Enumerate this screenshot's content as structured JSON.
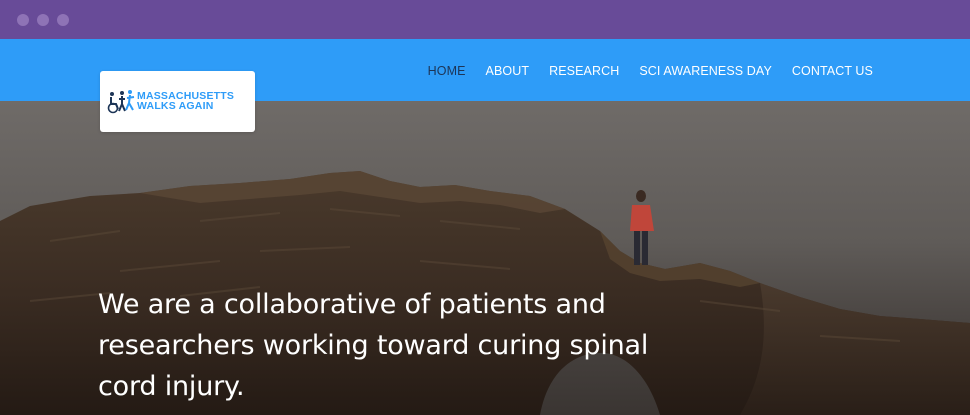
{
  "window": {
    "controls": [
      "close",
      "minimize",
      "maximize"
    ]
  },
  "brand": {
    "line1": "MASSACHUSETTS",
    "line2": "WALKS AGAIN",
    "logo_icon": "people-walking-wheelchair-icon",
    "color": "#2e9cf8"
  },
  "nav": {
    "items": [
      {
        "label": "HOME",
        "active": true
      },
      {
        "label": "ABOUT",
        "active": false
      },
      {
        "label": "RESEARCH",
        "active": false
      },
      {
        "label": "SCI AWARENESS DAY",
        "active": false
      },
      {
        "label": "CONTACT US",
        "active": false
      }
    ]
  },
  "hero": {
    "tagline": "We are a collaborative of patients and researchers working toward curing spinal cord injury."
  },
  "colors": {
    "titlebar": "#684b98",
    "navbar": "#2e9cf8",
    "active_nav": "#1d3557"
  }
}
